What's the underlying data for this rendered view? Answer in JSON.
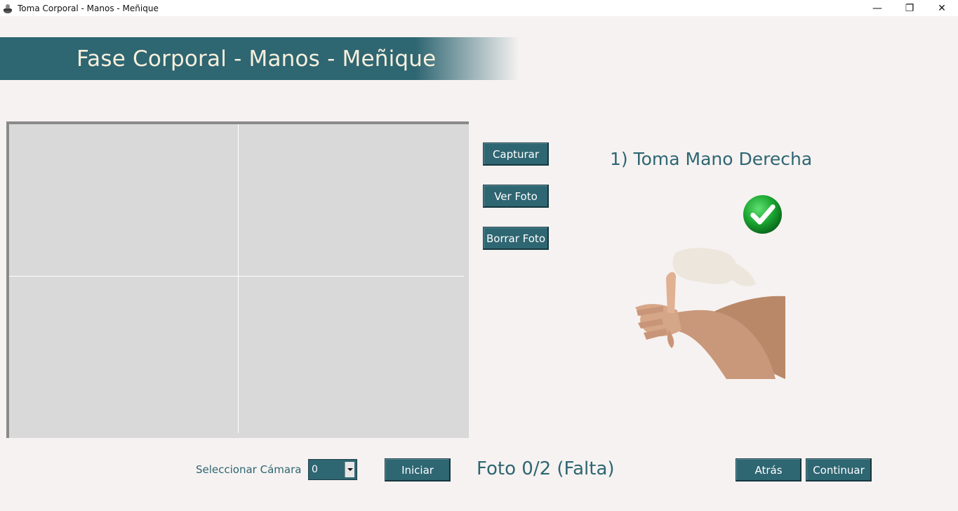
{
  "window": {
    "title": "Toma Corporal - Manos - Meñique",
    "minimize_glyph": "—",
    "restore_glyph": "❐",
    "close_glyph": "✕"
  },
  "header": {
    "title": "Fase Corporal - Manos - Meñique"
  },
  "actions": {
    "capture_label": "Capturar",
    "view_photo_label": "Ver Foto",
    "delete_photo_label": "Borrar Foto"
  },
  "instructions": {
    "step_title": "1) Toma Mano Derecha",
    "status_icon": "check-circle-icon",
    "illustration": "pinky-finger-hand-illustration"
  },
  "camera": {
    "label": "Seleccionar Cámara",
    "selected": "0",
    "start_label": "Iniciar"
  },
  "progress": {
    "status_text": "Foto 0/2 (Falta)"
  },
  "navigation": {
    "back_label": "Atrás",
    "continue_label": "Continuar"
  },
  "colors": {
    "accent": "#2e6672",
    "background": "#f6f2f1",
    "banner_text": "#f7efdc",
    "preview_bg": "#d9d9d9",
    "success": "#1aa531"
  }
}
